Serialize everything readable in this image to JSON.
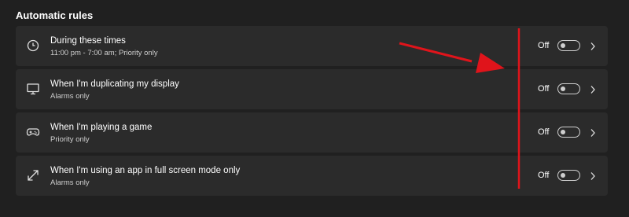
{
  "section": {
    "title": "Automatic rules"
  },
  "rules": [
    {
      "icon": "clock-icon",
      "title": "During these times",
      "subtitle": "11:00 pm - 7:00 am; Priority only",
      "state": "Off"
    },
    {
      "icon": "monitor-icon",
      "title": "When I'm duplicating my display",
      "subtitle": "Alarms only",
      "state": "Off"
    },
    {
      "icon": "gamepad-icon",
      "title": "When I'm playing a game",
      "subtitle": "Priority only",
      "state": "Off"
    },
    {
      "icon": "fullscreen-arrows-icon",
      "title": "When I'm using an app in full screen mode only",
      "subtitle": "Alarms only",
      "state": "Off"
    }
  ],
  "colors": {
    "background": "#202020",
    "card": "#2b2b2b",
    "annotation": "#e0141b"
  }
}
